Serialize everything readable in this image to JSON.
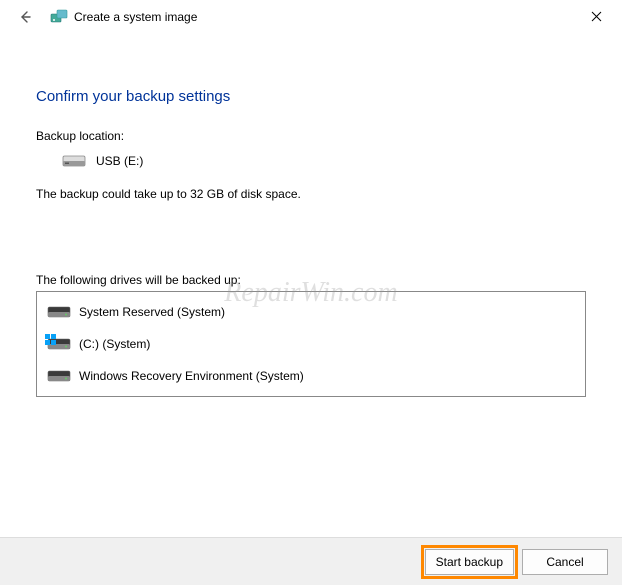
{
  "window": {
    "title": "Create a system image"
  },
  "heading": "Confirm your backup settings",
  "backup_location_label": "Backup location:",
  "backup_location_value": "USB (E:)",
  "size_note": "The backup could take up to 32 GB of disk space.",
  "drives_label": "The following drives will be backed up:",
  "drives": [
    {
      "label": "System Reserved (System)"
    },
    {
      "label": "(C:) (System)"
    },
    {
      "label": "Windows Recovery Environment (System)"
    }
  ],
  "buttons": {
    "start": "Start backup",
    "cancel": "Cancel"
  },
  "watermark": "RepairWin.com"
}
